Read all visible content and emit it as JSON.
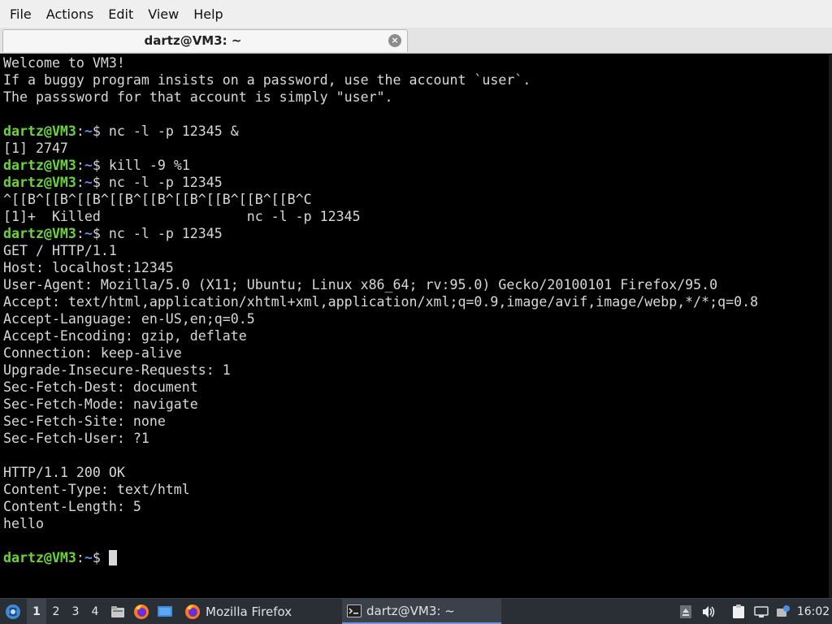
{
  "menubar": {
    "items": [
      "File",
      "Actions",
      "Edit",
      "View",
      "Help"
    ]
  },
  "tab": {
    "title": "dartz@VM3: ~",
    "close_glyph": "×"
  },
  "prompt": {
    "user_host": "dartz@VM3",
    "colon": ":",
    "path": "~",
    "symbol": "$ "
  },
  "terminal": {
    "lines": [
      {
        "type": "text",
        "text": "Welcome to VM3!"
      },
      {
        "type": "text",
        "text": "If a buggy program insists on a password, use the account `user`."
      },
      {
        "type": "text",
        "text": "The passsword for that account is simply \"user\"."
      },
      {
        "type": "text",
        "text": ""
      },
      {
        "type": "prompt",
        "cmd": "nc -l -p 12345 &"
      },
      {
        "type": "text",
        "text": "[1] 2747"
      },
      {
        "type": "prompt",
        "cmd": "kill -9 %1"
      },
      {
        "type": "prompt",
        "cmd": "nc -l -p 12345"
      },
      {
        "type": "text",
        "text": "^[[B^[[B^[[B^[[B^[[B^[[B^[[B^[[B^[[B^C"
      },
      {
        "type": "text",
        "text": "[1]+  Killed                  nc -l -p 12345"
      },
      {
        "type": "prompt",
        "cmd": "nc -l -p 12345"
      },
      {
        "type": "text",
        "text": "GET / HTTP/1.1"
      },
      {
        "type": "text",
        "text": "Host: localhost:12345"
      },
      {
        "type": "text",
        "text": "User-Agent: Mozilla/5.0 (X11; Ubuntu; Linux x86_64; rv:95.0) Gecko/20100101 Firefox/95.0"
      },
      {
        "type": "text",
        "text": "Accept: text/html,application/xhtml+xml,application/xml;q=0.9,image/avif,image/webp,*/*;q=0.8"
      },
      {
        "type": "text",
        "text": "Accept-Language: en-US,en;q=0.5"
      },
      {
        "type": "text",
        "text": "Accept-Encoding: gzip, deflate"
      },
      {
        "type": "text",
        "text": "Connection: keep-alive"
      },
      {
        "type": "text",
        "text": "Upgrade-Insecure-Requests: 1"
      },
      {
        "type": "text",
        "text": "Sec-Fetch-Dest: document"
      },
      {
        "type": "text",
        "text": "Sec-Fetch-Mode: navigate"
      },
      {
        "type": "text",
        "text": "Sec-Fetch-Site: none"
      },
      {
        "type": "text",
        "text": "Sec-Fetch-User: ?1"
      },
      {
        "type": "text",
        "text": ""
      },
      {
        "type": "text",
        "text": "HTTP/1.1 200 OK"
      },
      {
        "type": "text",
        "text": "Content-Type: text/html"
      },
      {
        "type": "text",
        "text": "Content-Length: 5"
      },
      {
        "type": "text",
        "text": "hello"
      },
      {
        "type": "text",
        "text": ""
      },
      {
        "type": "prompt",
        "cmd": "",
        "cursor": true
      }
    ]
  },
  "taskbar": {
    "start_icon": "xubuntu-menu-icon",
    "workspaces": [
      "1",
      "2",
      "3",
      "4"
    ],
    "active_workspace": "1",
    "launchers": [
      "file-manager-icon",
      "firefox-icon",
      "desktop-icon"
    ],
    "tasks": [
      {
        "label": "Mozilla Firefox",
        "icon": "firefox-icon",
        "active": false
      },
      {
        "label": "dartz@VM3: ~",
        "icon": "terminal-icon",
        "active": true
      }
    ],
    "tray_icons": [
      "eject-icon",
      "volume-icon",
      "clipboard-icon",
      "network-icon",
      "update-icon"
    ],
    "clock": "16:02"
  },
  "colors": {
    "terminal_bg": "#000000",
    "terminal_fg": "#d8d8d8",
    "prompt_user": "#6ad43b",
    "prompt_path": "#5c8cf4",
    "taskbar_bg": "#2a2f36",
    "menubar_bg": "#efefef"
  }
}
